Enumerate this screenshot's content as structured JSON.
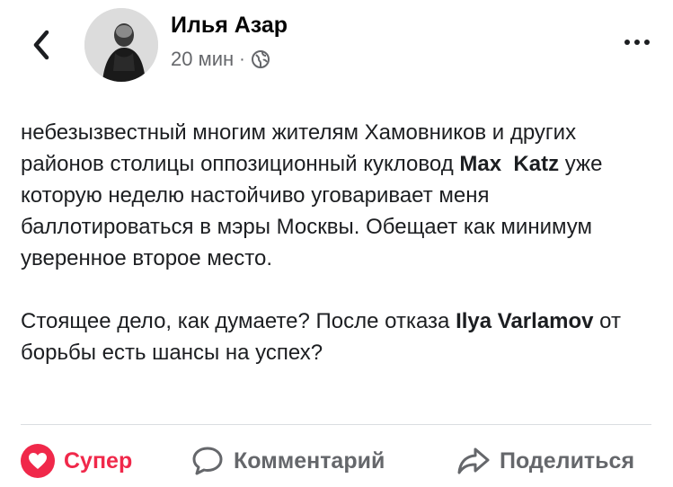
{
  "header": {
    "author_name": "Илья Азар",
    "time": "20 мин",
    "separator": "·",
    "privacy_icon": "globe-icon",
    "back_icon": "chevron-left-icon",
    "more_icon": "more-horizontal-icon"
  },
  "post": {
    "p1_part1": "небезызвестный многим жителям Хамовников и других районов столицы оппозиционный кукловод ",
    "p1_mention": "Max  Katz",
    "p1_part2": " уже которую неделю настойчиво уговаривает меня баллотироваться в мэры Москвы. Обещает как минимум уверенное второе место.",
    "p2_part1": "Стоящее дело, как думаете? После отказа ",
    "p2_mention": "Ilya Varlamov",
    "p2_part2": " от борьбы есть шансы на успех?"
  },
  "actions": {
    "super_label": "Супер",
    "comment_label": "Комментарий",
    "share_label": "Поделиться",
    "super_icon": "heart-icon",
    "comment_icon": "comment-icon",
    "share_icon": "share-arrow-icon"
  },
  "colors": {
    "accent_reaction": "#f0284a",
    "secondary_text": "#65676b",
    "primary_text": "#1c1e21"
  }
}
